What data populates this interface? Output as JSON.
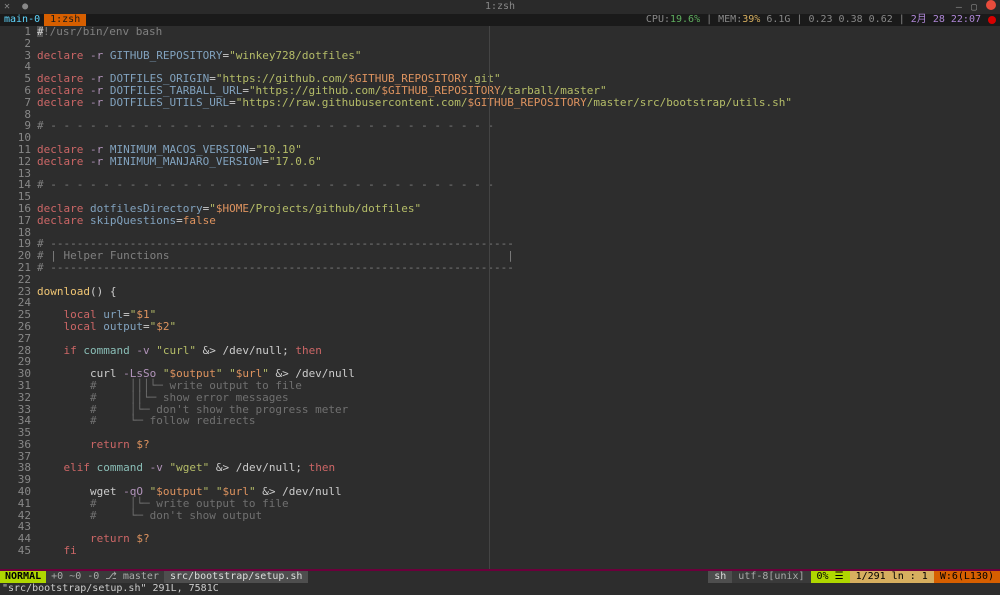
{
  "titlebar": {
    "title": "1:zsh"
  },
  "tmux": {
    "session": "main-0",
    "window": "1:zsh",
    "cpu_label": "CPU:",
    "cpu_pct": "19.6%",
    "mem_label": "MEM:",
    "mem_pct": "39%",
    "mem_val": "6.1G",
    "load": "0.23 0.38 0.62",
    "date": "2月  28 22:07"
  },
  "lines": [
    {
      "n": 1,
      "tokens": [
        {
          "cls": "comment",
          "t": "!/usr/bin/env bash"
        }
      ]
    },
    {
      "n": 2,
      "tokens": []
    },
    {
      "n": 3,
      "tokens": [
        {
          "cls": "kw",
          "t": "declare"
        },
        {
          "cls": "op",
          "t": " "
        },
        {
          "cls": "flag",
          "t": "-r"
        },
        {
          "cls": "op",
          "t": " "
        },
        {
          "cls": "var",
          "t": "GITHUB_REPOSITORY"
        },
        {
          "cls": "op",
          "t": "="
        },
        {
          "cls": "str",
          "t": "\"winkey728/dotfiles\""
        }
      ]
    },
    {
      "n": 4,
      "tokens": []
    },
    {
      "n": 5,
      "tokens": [
        {
          "cls": "kw",
          "t": "declare"
        },
        {
          "cls": "op",
          "t": " "
        },
        {
          "cls": "flag",
          "t": "-r"
        },
        {
          "cls": "op",
          "t": " "
        },
        {
          "cls": "var",
          "t": "DOTFILES_ORIGIN"
        },
        {
          "cls": "op",
          "t": "="
        },
        {
          "cls": "str",
          "t": "\"https://github.com/"
        },
        {
          "cls": "str2",
          "t": "$GITHUB_REPOSITORY"
        },
        {
          "cls": "str",
          "t": ".git\""
        }
      ]
    },
    {
      "n": 6,
      "tokens": [
        {
          "cls": "kw",
          "t": "declare"
        },
        {
          "cls": "op",
          "t": " "
        },
        {
          "cls": "flag",
          "t": "-r"
        },
        {
          "cls": "op",
          "t": " "
        },
        {
          "cls": "var",
          "t": "DOTFILES_TARBALL_URL"
        },
        {
          "cls": "op",
          "t": "="
        },
        {
          "cls": "str",
          "t": "\"https://github.com/"
        },
        {
          "cls": "str2",
          "t": "$GITHUB_REPOSITORY"
        },
        {
          "cls": "str",
          "t": "/tarball/master\""
        }
      ]
    },
    {
      "n": 7,
      "tokens": [
        {
          "cls": "kw",
          "t": "declare"
        },
        {
          "cls": "op",
          "t": " "
        },
        {
          "cls": "flag",
          "t": "-r"
        },
        {
          "cls": "op",
          "t": " "
        },
        {
          "cls": "var",
          "t": "DOTFILES_UTILS_URL"
        },
        {
          "cls": "op",
          "t": "="
        },
        {
          "cls": "str",
          "t": "\"https://raw.githubusercontent.com/"
        },
        {
          "cls": "str2",
          "t": "$GITHUB_REPOSITORY"
        },
        {
          "cls": "str",
          "t": "/master/src/bootstrap/utils.sh\""
        }
      ]
    },
    {
      "n": 8,
      "tokens": []
    },
    {
      "n": 9,
      "tokens": [
        {
          "cls": "comment",
          "t": "# - - - - - - - - - - - - - - - - - - - - - - - - - - - - - - - - - -"
        }
      ]
    },
    {
      "n": 10,
      "tokens": []
    },
    {
      "n": 11,
      "tokens": [
        {
          "cls": "kw",
          "t": "declare"
        },
        {
          "cls": "op",
          "t": " "
        },
        {
          "cls": "flag",
          "t": "-r"
        },
        {
          "cls": "op",
          "t": " "
        },
        {
          "cls": "var",
          "t": "MINIMUM_MACOS_VERSION"
        },
        {
          "cls": "op",
          "t": "="
        },
        {
          "cls": "str",
          "t": "\"10.10\""
        }
      ]
    },
    {
      "n": 12,
      "tokens": [
        {
          "cls": "kw",
          "t": "declare"
        },
        {
          "cls": "op",
          "t": " "
        },
        {
          "cls": "flag",
          "t": "-r"
        },
        {
          "cls": "op",
          "t": " "
        },
        {
          "cls": "var",
          "t": "MINIMUM_MANJARO_VERSION"
        },
        {
          "cls": "op",
          "t": "="
        },
        {
          "cls": "str",
          "t": "\"17.0.6\""
        }
      ]
    },
    {
      "n": 13,
      "tokens": []
    },
    {
      "n": 14,
      "tokens": [
        {
          "cls": "comment",
          "t": "# - - - - - - - - - - - - - - - - - - - - - - - - - - - - - - - - - -"
        }
      ]
    },
    {
      "n": 15,
      "tokens": []
    },
    {
      "n": 16,
      "tokens": [
        {
          "cls": "kw",
          "t": "declare"
        },
        {
          "cls": "op",
          "t": " "
        },
        {
          "cls": "var",
          "t": "dotfilesDirectory"
        },
        {
          "cls": "op",
          "t": "="
        },
        {
          "cls": "str",
          "t": "\""
        },
        {
          "cls": "str2",
          "t": "$HOME"
        },
        {
          "cls": "str",
          "t": "/Projects/github/dotfiles\""
        }
      ]
    },
    {
      "n": 17,
      "tokens": [
        {
          "cls": "kw",
          "t": "declare"
        },
        {
          "cls": "op",
          "t": " "
        },
        {
          "cls": "var",
          "t": "skipQuestions"
        },
        {
          "cls": "op",
          "t": "="
        },
        {
          "cls": "num",
          "t": "false"
        }
      ]
    },
    {
      "n": 18,
      "tokens": []
    },
    {
      "n": 19,
      "tokens": [
        {
          "cls": "comment",
          "t": "# ----------------------------------------------------------------------"
        }
      ]
    },
    {
      "n": 20,
      "tokens": [
        {
          "cls": "comment",
          "t": "# | Helper Functions                                                   |"
        }
      ]
    },
    {
      "n": 21,
      "tokens": [
        {
          "cls": "comment",
          "t": "# ----------------------------------------------------------------------"
        }
      ]
    },
    {
      "n": 22,
      "tokens": []
    },
    {
      "n": 23,
      "tokens": [
        {
          "cls": "func",
          "t": "download"
        },
        {
          "cls": "op",
          "t": "() {"
        }
      ]
    },
    {
      "n": 24,
      "tokens": []
    },
    {
      "n": 25,
      "tokens": [
        {
          "cls": "op",
          "t": "    "
        },
        {
          "cls": "kw",
          "t": "local"
        },
        {
          "cls": "op",
          "t": " "
        },
        {
          "cls": "var",
          "t": "url"
        },
        {
          "cls": "op",
          "t": "="
        },
        {
          "cls": "str",
          "t": "\""
        },
        {
          "cls": "str2",
          "t": "$1"
        },
        {
          "cls": "str",
          "t": "\""
        }
      ]
    },
    {
      "n": 26,
      "tokens": [
        {
          "cls": "op",
          "t": "    "
        },
        {
          "cls": "kw",
          "t": "local"
        },
        {
          "cls": "op",
          "t": " "
        },
        {
          "cls": "var",
          "t": "output"
        },
        {
          "cls": "op",
          "t": "="
        },
        {
          "cls": "str",
          "t": "\""
        },
        {
          "cls": "str2",
          "t": "$2"
        },
        {
          "cls": "str",
          "t": "\""
        }
      ]
    },
    {
      "n": 27,
      "tokens": []
    },
    {
      "n": 28,
      "tokens": [
        {
          "cls": "op",
          "t": "    "
        },
        {
          "cls": "kw",
          "t": "if"
        },
        {
          "cls": "op",
          "t": " "
        },
        {
          "cls": "builtin",
          "t": "command"
        },
        {
          "cls": "op",
          "t": " "
        },
        {
          "cls": "flag",
          "t": "-v"
        },
        {
          "cls": "op",
          "t": " "
        },
        {
          "cls": "str",
          "t": "\"curl\""
        },
        {
          "cls": "op",
          "t": " &> /dev/null; "
        },
        {
          "cls": "kw",
          "t": "then"
        }
      ]
    },
    {
      "n": 29,
      "tokens": []
    },
    {
      "n": 30,
      "tokens": [
        {
          "cls": "op",
          "t": "        curl "
        },
        {
          "cls": "flag",
          "t": "-LsSo"
        },
        {
          "cls": "op",
          "t": " "
        },
        {
          "cls": "str",
          "t": "\""
        },
        {
          "cls": "str2",
          "t": "$output"
        },
        {
          "cls": "str",
          "t": "\""
        },
        {
          "cls": "op",
          "t": " "
        },
        {
          "cls": "str",
          "t": "\""
        },
        {
          "cls": "str2",
          "t": "$url"
        },
        {
          "cls": "str",
          "t": "\""
        },
        {
          "cls": "op",
          "t": " &> /dev/null"
        }
      ]
    },
    {
      "n": 31,
      "tokens": [
        {
          "cls": "op",
          "t": "        "
        },
        {
          "cls": "cmt2",
          "t": "#     │││└─ write output to file"
        }
      ]
    },
    {
      "n": 32,
      "tokens": [
        {
          "cls": "op",
          "t": "        "
        },
        {
          "cls": "cmt2",
          "t": "#     ││└─ show error messages"
        }
      ]
    },
    {
      "n": 33,
      "tokens": [
        {
          "cls": "op",
          "t": "        "
        },
        {
          "cls": "cmt2",
          "t": "#     │└─ don't show the progress meter"
        }
      ]
    },
    {
      "n": 34,
      "tokens": [
        {
          "cls": "op",
          "t": "        "
        },
        {
          "cls": "cmt2",
          "t": "#     └─ follow redirects"
        }
      ]
    },
    {
      "n": 35,
      "tokens": []
    },
    {
      "n": 36,
      "tokens": [
        {
          "cls": "op",
          "t": "        "
        },
        {
          "cls": "kw",
          "t": "return"
        },
        {
          "cls": "op",
          "t": " "
        },
        {
          "cls": "str2",
          "t": "$?"
        }
      ]
    },
    {
      "n": 37,
      "tokens": []
    },
    {
      "n": 38,
      "tokens": [
        {
          "cls": "op",
          "t": "    "
        },
        {
          "cls": "kw",
          "t": "elif"
        },
        {
          "cls": "op",
          "t": " "
        },
        {
          "cls": "builtin",
          "t": "command"
        },
        {
          "cls": "op",
          "t": " "
        },
        {
          "cls": "flag",
          "t": "-v"
        },
        {
          "cls": "op",
          "t": " "
        },
        {
          "cls": "str",
          "t": "\"wget\""
        },
        {
          "cls": "op",
          "t": " &> /dev/null; "
        },
        {
          "cls": "kw",
          "t": "then"
        }
      ]
    },
    {
      "n": 39,
      "tokens": []
    },
    {
      "n": 40,
      "tokens": [
        {
          "cls": "op",
          "t": "        wget "
        },
        {
          "cls": "flag",
          "t": "-qO"
        },
        {
          "cls": "op",
          "t": " "
        },
        {
          "cls": "str",
          "t": "\""
        },
        {
          "cls": "str2",
          "t": "$output"
        },
        {
          "cls": "str",
          "t": "\""
        },
        {
          "cls": "op",
          "t": " "
        },
        {
          "cls": "str",
          "t": "\""
        },
        {
          "cls": "str2",
          "t": "$url"
        },
        {
          "cls": "str",
          "t": "\""
        },
        {
          "cls": "op",
          "t": " &> /dev/null"
        }
      ]
    },
    {
      "n": 41,
      "tokens": [
        {
          "cls": "op",
          "t": "        "
        },
        {
          "cls": "cmt2",
          "t": "#     │└─ write output to file"
        }
      ]
    },
    {
      "n": 42,
      "tokens": [
        {
          "cls": "op",
          "t": "        "
        },
        {
          "cls": "cmt2",
          "t": "#     └─ don't show output"
        }
      ]
    },
    {
      "n": 43,
      "tokens": []
    },
    {
      "n": 44,
      "tokens": [
        {
          "cls": "op",
          "t": "        "
        },
        {
          "cls": "kw",
          "t": "return"
        },
        {
          "cls": "op",
          "t": " "
        },
        {
          "cls": "str2",
          "t": "$?"
        }
      ]
    },
    {
      "n": 45,
      "tokens": [
        {
          "cls": "op",
          "t": "    "
        },
        {
          "cls": "kw",
          "t": "fi"
        }
      ]
    }
  ],
  "status": {
    "mode": "NORMAL",
    "git": "+0 ~0 -0 ⎇ master",
    "file": "src/bootstrap/setup.sh",
    "ft": "sh",
    "enc": "utf-8[unix]",
    "pct": "0% ☰",
    "pos": "1/291 ln : 1",
    "warn": "W:6(L130)"
  },
  "message": "\"src/bootstrap/setup.sh\" 291L, 7581C"
}
